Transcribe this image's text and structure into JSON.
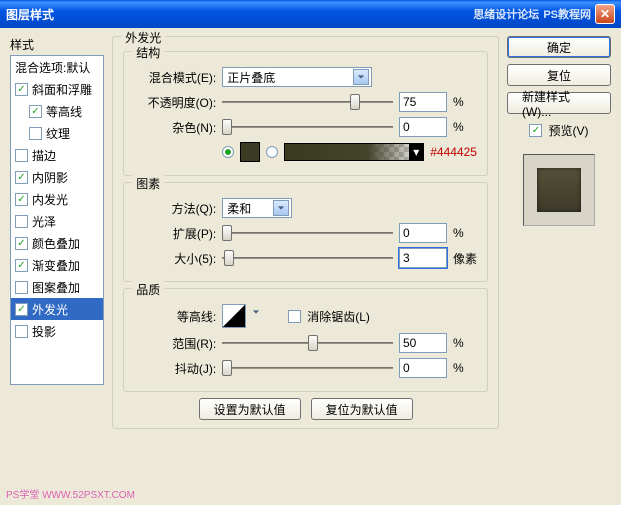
{
  "window": {
    "title": "图层样式",
    "watermark1": "思绪设计论坛",
    "watermark2": "PS教程网"
  },
  "sidebar": {
    "header": "样式",
    "blend": "混合选项:默认",
    "items": [
      {
        "label": "斜面和浮雕",
        "checked": true
      },
      {
        "label": "等高线",
        "checked": true,
        "indent": true
      },
      {
        "label": "纹理",
        "checked": false,
        "indent": true
      },
      {
        "label": "描边",
        "checked": false
      },
      {
        "label": "内阴影",
        "checked": true
      },
      {
        "label": "内发光",
        "checked": true
      },
      {
        "label": "光泽",
        "checked": false
      },
      {
        "label": "颜色叠加",
        "checked": true
      },
      {
        "label": "渐变叠加",
        "checked": true
      },
      {
        "label": "图案叠加",
        "checked": false
      },
      {
        "label": "外发光",
        "checked": true,
        "selected": true
      },
      {
        "label": "投影",
        "checked": false
      }
    ]
  },
  "panel": {
    "title": "外发光",
    "g_structure": "结构",
    "blend_mode_lbl": "混合模式(E):",
    "blend_mode_val": "正片叠底",
    "opacity_lbl": "不透明度(O):",
    "opacity_val": "75",
    "pct": "%",
    "noise_lbl": "杂色(N):",
    "noise_val": "0",
    "color_hex": "#444425",
    "g_elements": "图素",
    "technique_lbl": "方法(Q):",
    "technique_val": "柔和",
    "spread_lbl": "扩展(P):",
    "spread_val": "0",
    "size_lbl": "大小(5):",
    "size_val": "3",
    "px": "像素",
    "g_quality": "品质",
    "contour_lbl": "等高线:",
    "anti_lbl": "消除锯齿(L)",
    "range_lbl": "范围(R):",
    "range_val": "50",
    "jitter_lbl": "抖动(J):",
    "jitter_val": "0",
    "btn_default": "设置为默认值",
    "btn_reset": "复位为默认值"
  },
  "buttons": {
    "ok": "确定",
    "cancel": "复位",
    "new": "新建样式(W)...",
    "preview_cb": "预览(V)"
  },
  "footer": "PS学堂  WWW.52PSXT.COM"
}
